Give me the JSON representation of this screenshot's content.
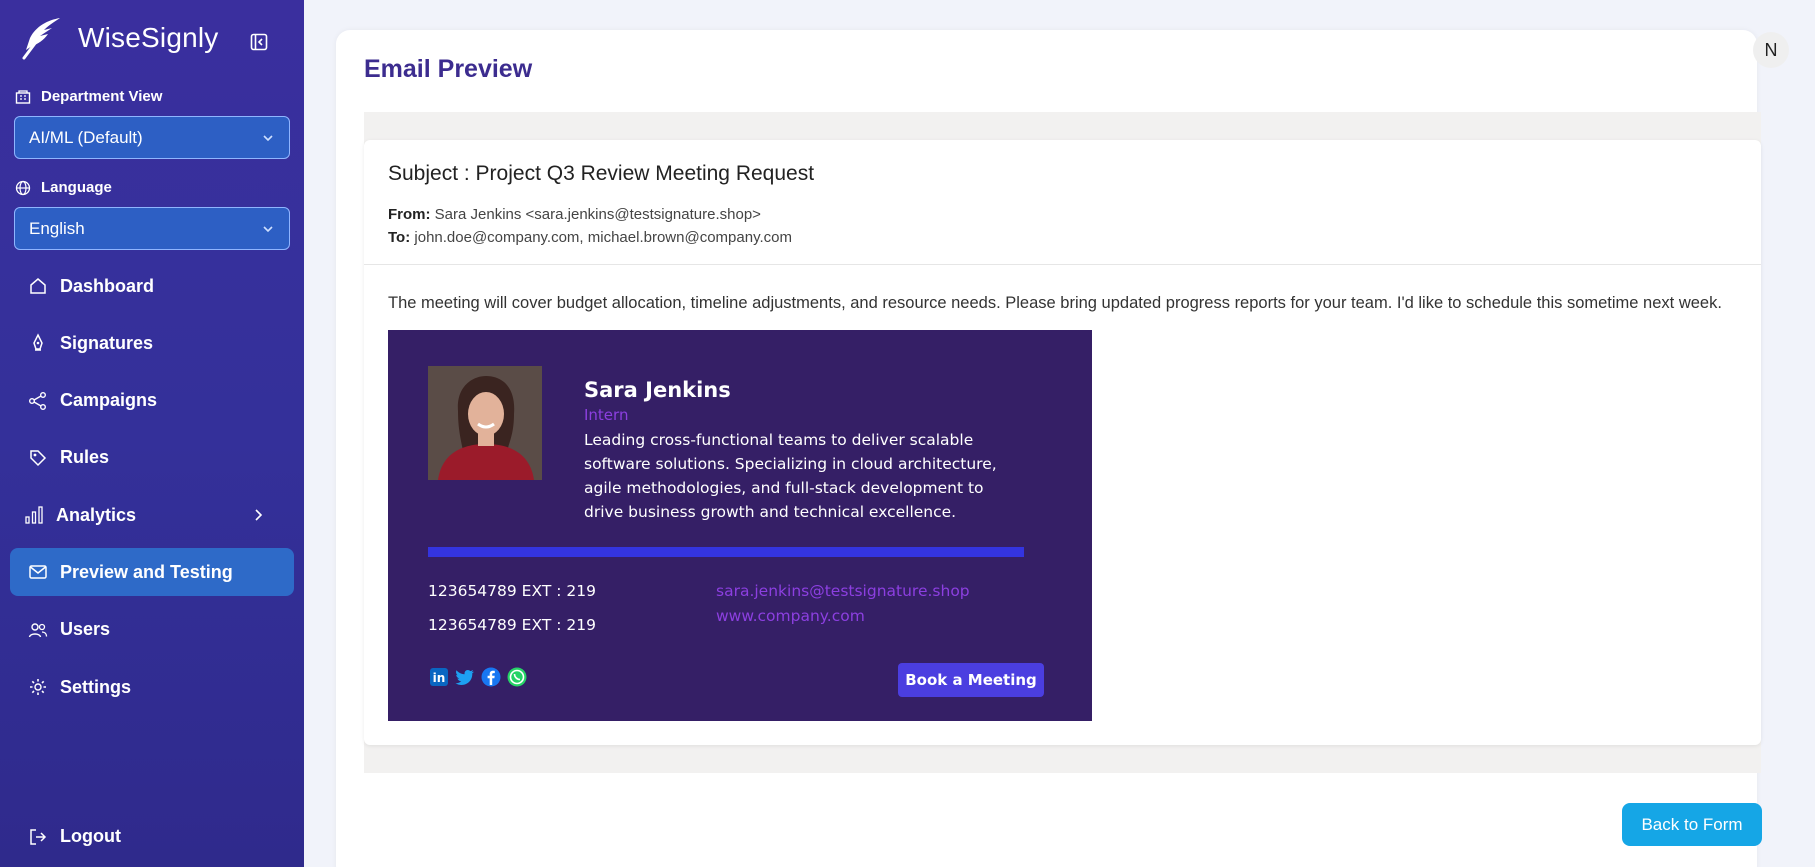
{
  "app": {
    "name": "WiseSignly"
  },
  "sidebar": {
    "department_label": "Department View",
    "department_value": "AI/ML (Default)",
    "language_label": "Language",
    "language_value": "English",
    "nav": [
      {
        "label": "Dashboard",
        "icon": "home-icon"
      },
      {
        "label": "Signatures",
        "icon": "pen-icon"
      },
      {
        "label": "Campaigns",
        "icon": "share-icon"
      },
      {
        "label": "Rules",
        "icon": "tag-icon"
      },
      {
        "label": "Analytics",
        "icon": "bar-chart-icon"
      },
      {
        "label": "Preview and Testing",
        "icon": "mail-icon",
        "active": true
      },
      {
        "label": "Users",
        "icon": "users-icon"
      },
      {
        "label": "Settings",
        "icon": "gear-icon"
      }
    ],
    "logout_label": "Logout"
  },
  "header": {
    "avatar_initial": "N"
  },
  "main": {
    "title": "Email Preview",
    "email": {
      "subject": "Subject : Project Q3 Review Meeting Request",
      "from_label": "From:",
      "from_value": "Sara Jenkins <sara.jenkins@testsignature.shop>",
      "to_label": "To:",
      "to_value": "john.doe@company.com, michael.brown@company.com",
      "body": "The meeting will cover budget allocation, timeline adjustments, and resource needs. Please bring updated progress reports for your team. I'd like to schedule this sometime next week."
    },
    "signature": {
      "name": "Sara Jenkins",
      "role": "Intern",
      "bio": "Leading cross-functional teams to deliver scalable software solutions. Specializing in cloud architecture, agile methodologies, and full-stack development to drive business growth and technical excellence.",
      "phone1": "123654789 EXT : 219",
      "phone2": "123654789 EXT : 219",
      "email": "sara.jenkins@testsignature.shop",
      "website": "www.company.com",
      "book_label": "Book a Meeting",
      "socials": [
        "linkedin-icon",
        "twitter-icon",
        "facebook-icon",
        "whatsapp-icon"
      ],
      "colors": {
        "background": "#351f66",
        "accent": "#8c3fe0",
        "bar": "#3434e0"
      }
    },
    "back_label": "Back to Form"
  }
}
